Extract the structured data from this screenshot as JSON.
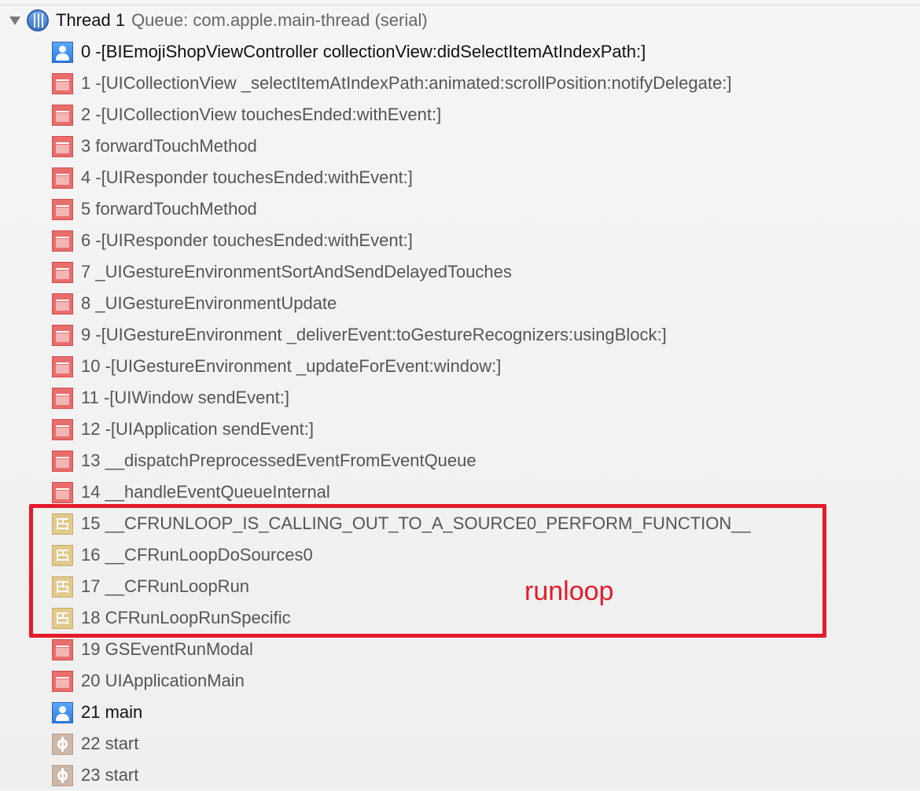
{
  "thread": {
    "title": "Thread 1",
    "queue": "Queue: com.apple.main-thread (serial)"
  },
  "frames": [
    {
      "text": "0 -[BIEmojiShopViewController collectionView:didSelectItemAtIndexPath:]",
      "icon": "user-code-icon",
      "kind": "user"
    },
    {
      "text": "1 -[UICollectionView _selectItemAtIndexPath:animated:scrollPosition:notifyDelegate:]",
      "icon": "framework-icon",
      "kind": "framework"
    },
    {
      "text": "2 -[UICollectionView touchesEnded:withEvent:]",
      "icon": "framework-icon",
      "kind": "framework"
    },
    {
      "text": "3 forwardTouchMethod",
      "icon": "framework-icon",
      "kind": "framework"
    },
    {
      "text": "4 -[UIResponder touchesEnded:withEvent:]",
      "icon": "framework-icon",
      "kind": "framework"
    },
    {
      "text": "5 forwardTouchMethod",
      "icon": "framework-icon",
      "kind": "framework"
    },
    {
      "text": "6 -[UIResponder touchesEnded:withEvent:]",
      "icon": "framework-icon",
      "kind": "framework"
    },
    {
      "text": "7 _UIGestureEnvironmentSortAndSendDelayedTouches",
      "icon": "framework-icon",
      "kind": "framework"
    },
    {
      "text": "8 _UIGestureEnvironmentUpdate",
      "icon": "framework-icon",
      "kind": "framework"
    },
    {
      "text": "9 -[UIGestureEnvironment _deliverEvent:toGestureRecognizers:usingBlock:]",
      "icon": "framework-icon",
      "kind": "framework"
    },
    {
      "text": "10 -[UIGestureEnvironment _updateForEvent:window:]",
      "icon": "framework-icon",
      "kind": "framework"
    },
    {
      "text": "11 -[UIWindow sendEvent:]",
      "icon": "framework-icon",
      "kind": "framework"
    },
    {
      "text": "12 -[UIApplication sendEvent:]",
      "icon": "framework-icon",
      "kind": "framework"
    },
    {
      "text": "13 __dispatchPreprocessedEventFromEventQueue",
      "icon": "framework-icon",
      "kind": "framework"
    },
    {
      "text": "14 __handleEventQueueInternal",
      "icon": "framework-icon",
      "kind": "framework"
    },
    {
      "text": "15 __CFRUNLOOP_IS_CALLING_OUT_TO_A_SOURCE0_PERFORM_FUNCTION__",
      "icon": "corefoundation-icon",
      "kind": "corefoundation"
    },
    {
      "text": "16 __CFRunLoopDoSources0",
      "icon": "corefoundation-icon",
      "kind": "corefoundation"
    },
    {
      "text": "17 __CFRunLoopRun",
      "icon": "corefoundation-icon",
      "kind": "corefoundation"
    },
    {
      "text": "18 CFRunLoopRunSpecific",
      "icon": "corefoundation-icon",
      "kind": "corefoundation"
    },
    {
      "text": "19 GSEventRunModal",
      "icon": "framework-icon",
      "kind": "framework"
    },
    {
      "text": "20 UIApplicationMain",
      "icon": "framework-icon",
      "kind": "framework"
    },
    {
      "text": "21 main",
      "icon": "user-code-icon",
      "kind": "user"
    },
    {
      "text": "22 start",
      "icon": "system-icon",
      "kind": "system"
    },
    {
      "text": "23 start",
      "icon": "system-icon",
      "kind": "system"
    }
  ],
  "annotation": {
    "label": "runloop",
    "color": "#e41b2b"
  }
}
